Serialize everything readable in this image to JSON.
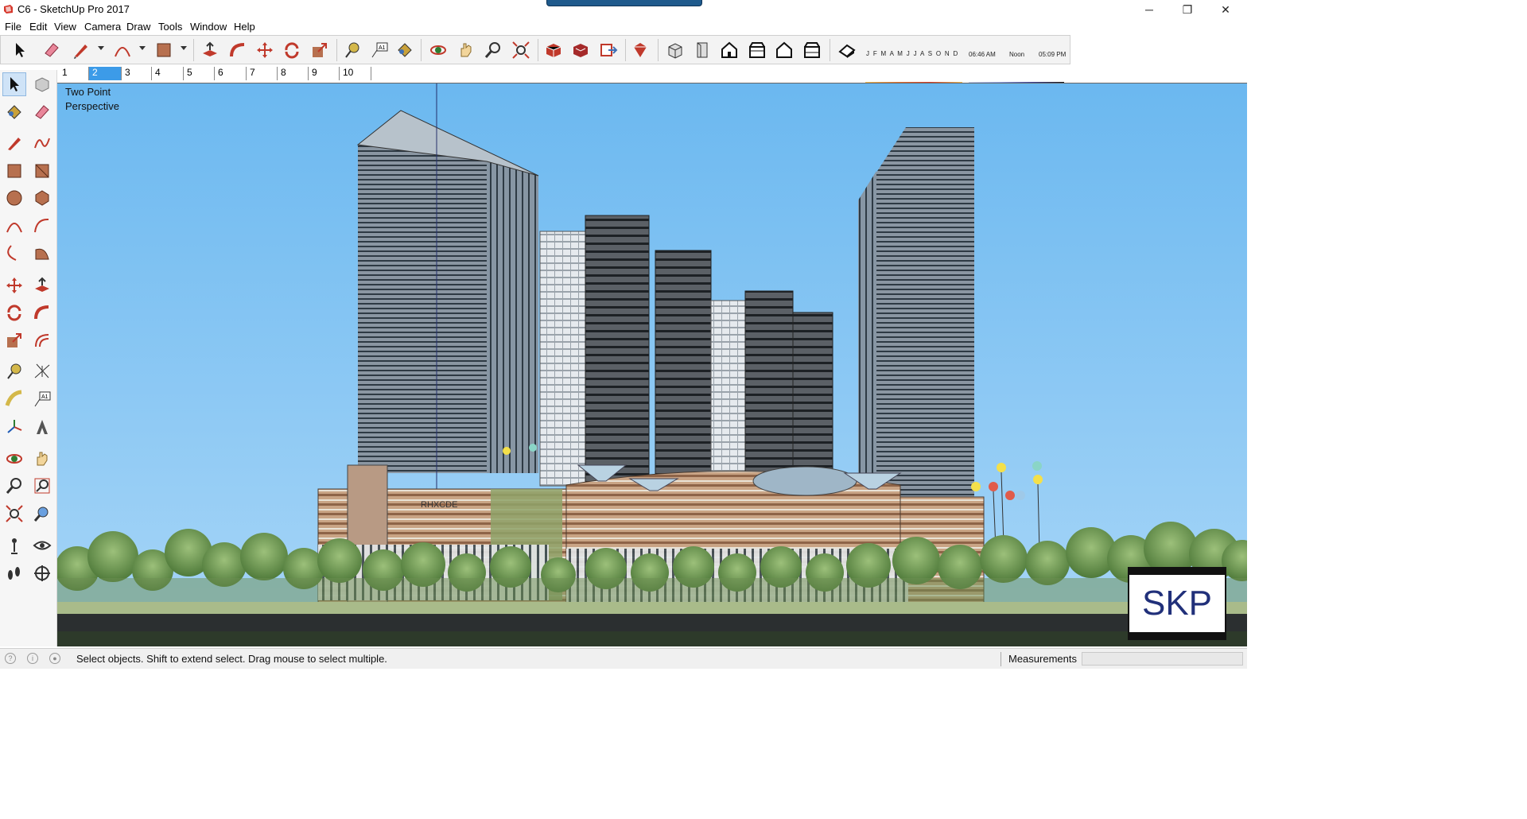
{
  "window": {
    "title": "C6 - SketchUp Pro 2017",
    "controls": {
      "minimize": "─",
      "maximize": "❐",
      "close": "✕"
    }
  },
  "menu": [
    "File",
    "Edit",
    "View",
    "Camera",
    "Draw",
    "Tools",
    "Window",
    "Help"
  ],
  "toolbar": {
    "tools": [
      "select-icon",
      "eraser-icon",
      "pencil-line-icon",
      "arc-icon",
      "rectangle-icon",
      "push-pull-icon",
      "follow-me-icon",
      "move-icon",
      "rotate-icon",
      "scale-icon",
      "tape-measure-icon",
      "text-icon",
      "paint-bucket-icon",
      "orbit-icon",
      "pan-icon",
      "zoom-icon",
      "zoom-extents-icon",
      "3d-warehouse-icon",
      "extension-warehouse-icon",
      "layout-send-icon",
      "extension-manager-icon",
      "iso-view-icon",
      "top-view-icon",
      "front-view-icon",
      "right-view-icon",
      "back-view-icon",
      "left-view-icon",
      "shadows-toggle-icon"
    ],
    "shadow_months": "J F M A M J J A S O N D",
    "shadow_time_start": "06:46 AM",
    "shadow_time_noon": "Noon",
    "shadow_time_end": "05:09 PM"
  },
  "scenes": {
    "tabs": [
      "1",
      "2",
      "3",
      "4",
      "5",
      "6",
      "7",
      "8",
      "9",
      "10"
    ],
    "active": "2"
  },
  "left_toolbar": {
    "tools": [
      "select-icon",
      "make-component-icon",
      "paint-bucket-icon",
      "eraser-icon",
      "line-icon",
      "freehand-icon",
      "rectangle-icon",
      "rotated-rectangle-icon",
      "circle-icon",
      "polygon-icon",
      "arc-icon",
      "two-point-arc-icon",
      "three-point-arc-icon",
      "pie-icon",
      "move-icon",
      "push-pull-icon",
      "rotate-icon",
      "follow-me-icon",
      "scale-icon",
      "offset-icon",
      "tape-measure-icon",
      "dimension-icon",
      "protractor-icon",
      "text-icon",
      "axes-icon",
      "3d-text-icon",
      "orbit-icon",
      "pan-icon",
      "zoom-icon",
      "zoom-window-icon",
      "zoom-extents-icon",
      "previous-view-icon",
      "position-camera-icon",
      "look-around-icon",
      "walk-icon",
      "section-plane-icon"
    ],
    "selected": "select-icon"
  },
  "viewport": {
    "camera_label_line1": "Two Point",
    "camera_label_line2": "Perspective",
    "sign_text": "RHXCDE",
    "watermark": "SKP",
    "colors": {
      "sky_top": "#6bb8f0",
      "sky_bottom": "#a8d6f7",
      "ground": "#2d3a2a"
    }
  },
  "statusbar": {
    "hint": "Select objects. Shift to extend select. Drag mouse to select multiple.",
    "measurements_label": "Measurements",
    "measurements_value": ""
  }
}
